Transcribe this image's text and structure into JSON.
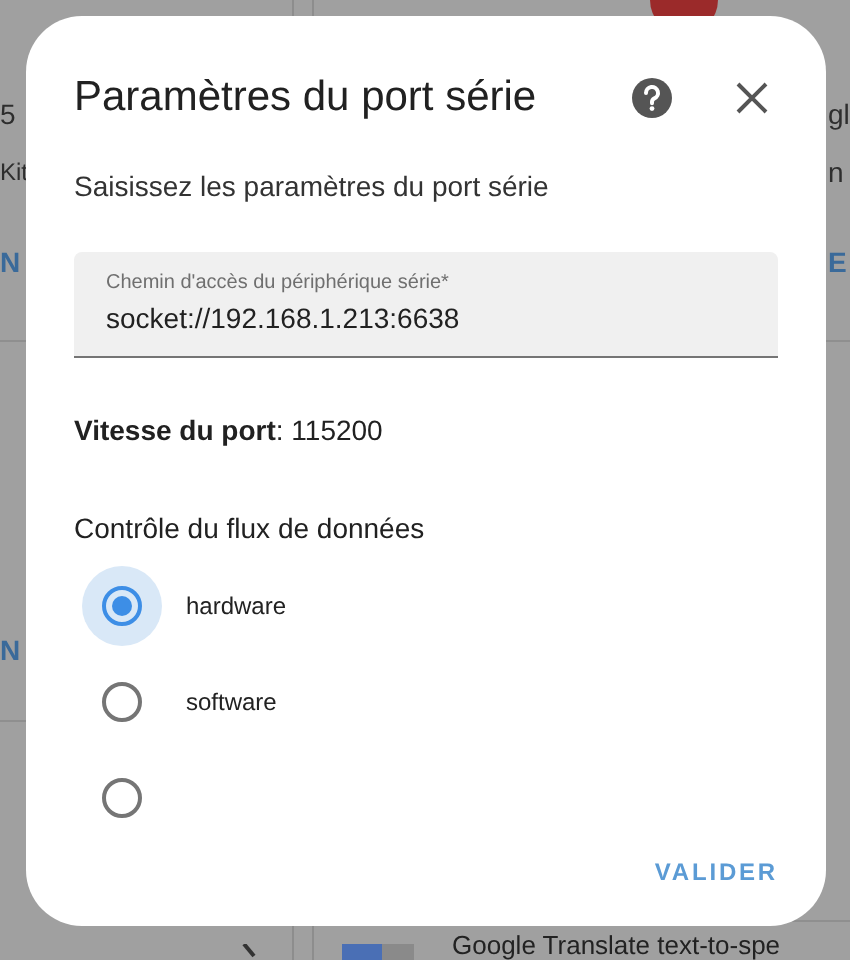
{
  "background": {
    "texts": [
      {
        "kind": "text",
        "text": "5"
      },
      {
        "kind": "text",
        "text": "Kit"
      },
      {
        "kind": "link",
        "text": "N"
      },
      {
        "kind": "link",
        "text": "N"
      },
      {
        "kind": "text",
        "text": "gl"
      },
      {
        "kind": "text",
        "text": "n"
      },
      {
        "kind": "link",
        "text": "E"
      },
      {
        "kind": "title",
        "text": "Google Translate text-to-spe"
      }
    ]
  },
  "dialog": {
    "title": "Paramètres du port série",
    "subtitle": "Saisissez les paramètres du port série",
    "field": {
      "label": "Chemin d'accès du périphérique série*",
      "value": "socket://192.168.1.213:6638"
    },
    "port_speed": "**Vitesse du port**: 115200",
    "flow_control": {
      "label": "Contrôle du flux de données",
      "options": [
        {
          "label": "hardware",
          "selected": true
        },
        {
          "label": "software",
          "selected": false
        },
        {
          "selected": false
        }
      ]
    },
    "actions": [
      "VALIDER"
    ]
  }
}
